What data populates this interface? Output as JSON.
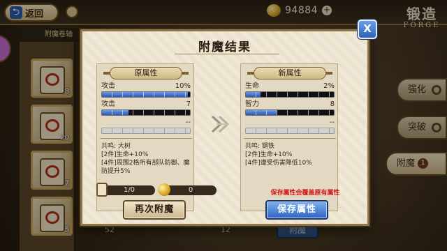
{
  "top_bar": {
    "back_label": "返回",
    "gold_value": "94884",
    "forge_title_cn": "锻造",
    "forge_title_en": "FORGE"
  },
  "sidebar": {
    "header": "附魔卷轴",
    "items": [
      {
        "count": "8"
      },
      {
        "count": "20"
      },
      {
        "count": "7"
      },
      {
        "count": "5"
      }
    ]
  },
  "right_tabs": [
    {
      "label": "强化"
    },
    {
      "label": "突破"
    },
    {
      "label": "附魔",
      "badge": "1"
    }
  ],
  "background": {
    "enchant_button": "附魔",
    "count_52": "52",
    "count_12": "12"
  },
  "modal": {
    "title": "附魔结果",
    "original": {
      "header": "原属性",
      "stats": [
        {
          "name": "攻击",
          "value": "10%",
          "fill_ratio": 0.98
        },
        {
          "name": "攻击",
          "value": "7",
          "fill_ratio": 0.3
        },
        {
          "name": "",
          "value": "--",
          "fill_ratio": 0
        }
      ],
      "resonance_title": "共鸣: 大树",
      "resonance_lines": [
        "[2件]生命+10%",
        "[4件]周围2格所有部队防御、魔防提升5%"
      ]
    },
    "new": {
      "header": "新属性",
      "stats": [
        {
          "name": "生命",
          "value": "2%",
          "fill_ratio": 0.17
        },
        {
          "name": "智力",
          "value": "8",
          "fill_ratio": 0.35
        },
        {
          "name": "",
          "value": "--",
          "fill_ratio": 0
        }
      ],
      "resonance_title": "共鸣: 钢铁",
      "resonance_lines": [
        "[2件]生命+10%",
        "[4件]遭受伤害降低10%"
      ]
    },
    "cost_scroll": "1/0",
    "cost_gold": "0",
    "warning": "保存属性会覆盖原有属性",
    "retry_label": "再次附魔",
    "save_label": "保存属性",
    "close_label": "X"
  }
}
